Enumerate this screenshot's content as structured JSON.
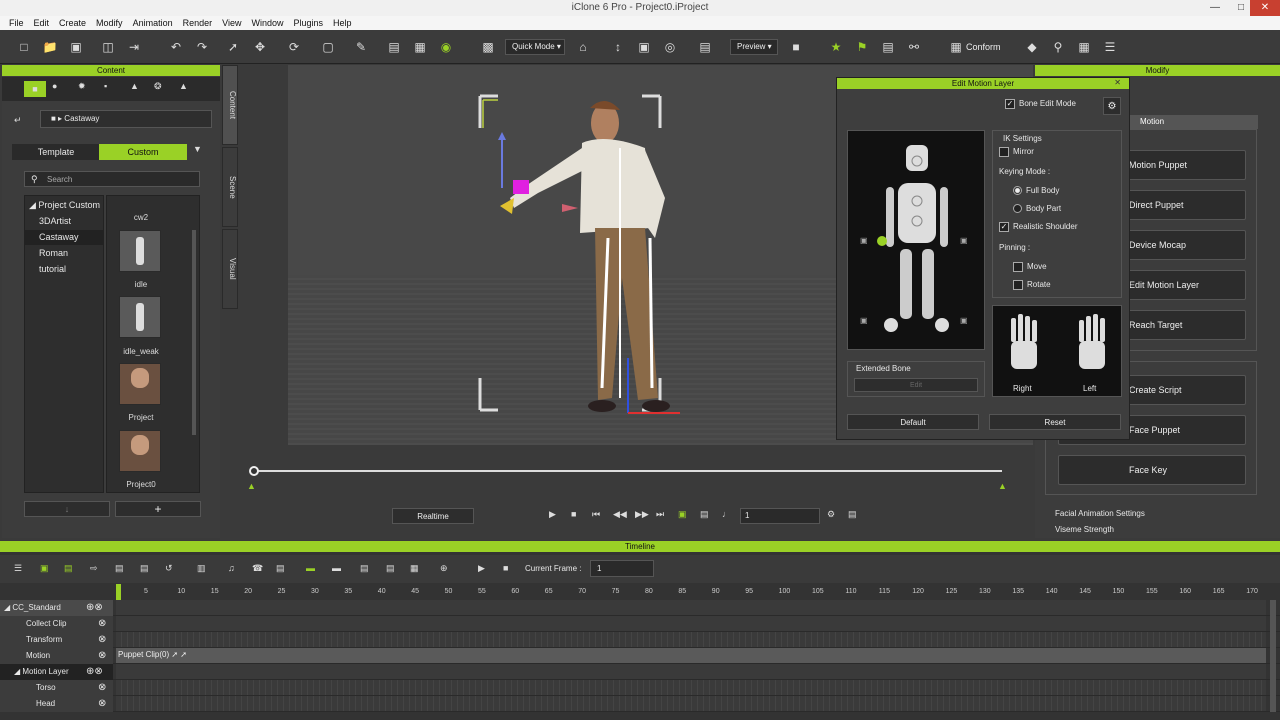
{
  "window": {
    "title": "iClone 6 Pro - Project0.iProject"
  },
  "menu": [
    "File",
    "Edit",
    "Create",
    "Modify",
    "Animation",
    "Render",
    "View",
    "Window",
    "Plugins",
    "Help"
  ],
  "toolbar": {
    "quick_mode": "Quick Mode",
    "preview": "Preview",
    "conform": "Conform"
  },
  "content": {
    "title": "Content",
    "breadcrumb": "Castaway",
    "tab_template": "Template",
    "tab_custom": "Custom",
    "search_placeholder": "Search",
    "tree": [
      "Project Custom",
      "3DArtist",
      "Castaway",
      "Roman",
      "tutorial"
    ],
    "thumbs": [
      "cw2",
      "idle",
      "idle_weak",
      "Project",
      "Project0"
    ],
    "side_tabs": [
      "Content",
      "Scene",
      "Visual"
    ]
  },
  "viewport": {
    "realtime": "Realtime",
    "frame_value": "1"
  },
  "motion_layer": {
    "title": "Edit Motion Layer",
    "bone_edit_mode": "Bone Edit Mode",
    "ik_settings": "IK Settings",
    "mirror": "Mirror",
    "keying_mode": "Keying Mode :",
    "full_body": "Full Body",
    "body_part": "Body Part",
    "realistic_shoulder": "Realistic Shoulder",
    "pinning": "Pinning :",
    "move": "Move",
    "rotate": "Rotate",
    "extended_bone": "Extended Bone",
    "edit": "Edit",
    "right": "Right",
    "left": "Left",
    "default": "Default",
    "reset": "Reset"
  },
  "modify": {
    "title": "Modify",
    "tab_motion": "Motion",
    "buttons": [
      "Motion Puppet",
      "Direct Puppet",
      "Device Mocap",
      "Edit Motion Layer",
      "Reach Target",
      "Create Script",
      "Face Puppet",
      "Face Key"
    ],
    "facial_settings": "Facial Animation Settings",
    "viseme_strength": "Viseme Strength"
  },
  "timeline": {
    "title": "Timeline",
    "current_frame_label": "Current Frame :",
    "current_frame": "1",
    "ticks": [
      "5",
      "10",
      "15",
      "20",
      "25",
      "30",
      "35",
      "40",
      "45",
      "50",
      "55",
      "60",
      "65",
      "70",
      "75",
      "80",
      "85",
      "90",
      "95",
      "100",
      "105",
      "110",
      "115",
      "120",
      "125",
      "130",
      "135",
      "140",
      "145",
      "150",
      "155",
      "160",
      "165",
      "170"
    ],
    "rows": [
      "CC_Standard",
      "Collect Clip",
      "Transform",
      "Motion",
      "Motion Layer",
      "Torso",
      "Head"
    ],
    "clip_label": "Puppet Clip(0)"
  },
  "colors": {
    "accent": "#9ad126"
  }
}
